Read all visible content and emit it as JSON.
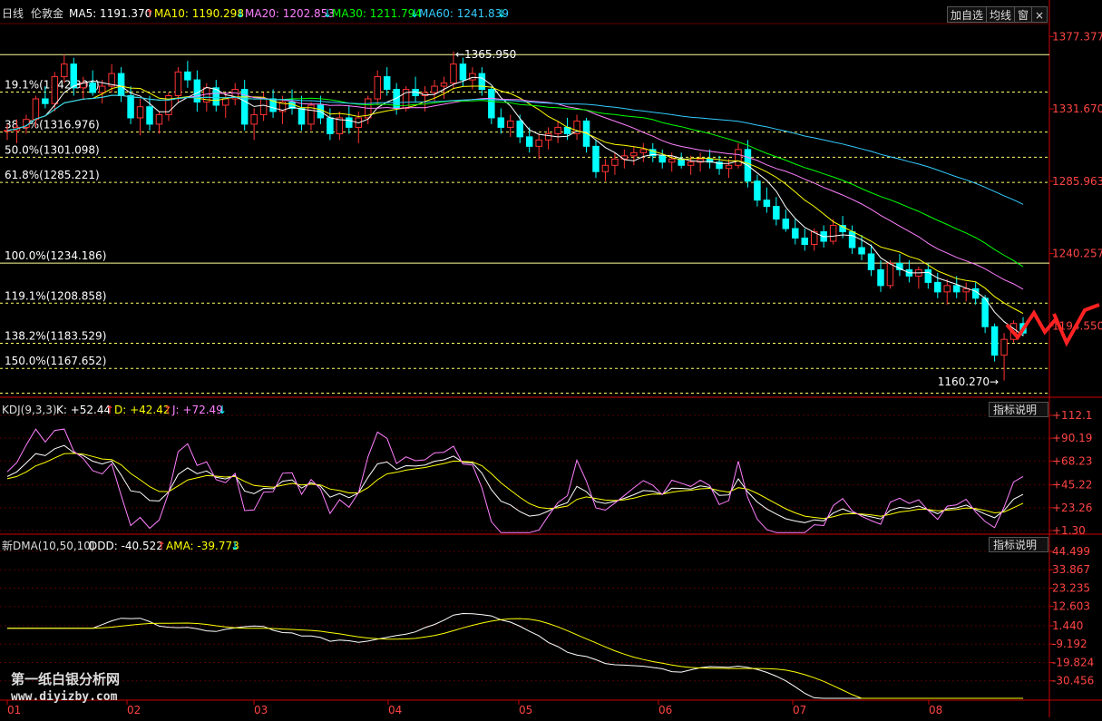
{
  "header": {
    "period": "日线",
    "symbol": "伦敦金",
    "ma5": "MA5: 1191.370",
    "ma10": "MA10: 1190.298",
    "ma20": "MA20: 1202.853",
    "ma30": "MA30: 1211.794",
    "ma60": "MA60: 1241.839",
    "arrow_up": "↑",
    "arrow_down": "↓",
    "btn_add": "加自选",
    "btn_avg": "均线",
    "btn_win": "窗",
    "btn_close": "×"
  },
  "main_chart": {
    "price_axis": [
      "1377.377",
      "1331.670",
      "1285.963",
      "1240.257",
      "1194.550"
    ],
    "fib_levels": [
      {
        "label": "19.1%(1342.304)",
        "value": 1342.304
      },
      {
        "label": "38.2%(1316.976)",
        "value": 1316.976
      },
      {
        "label": "50.0%(1301.098)",
        "value": 1301.098
      },
      {
        "label": "61.8%(1285.221)",
        "value": 1285.221
      },
      {
        "label": "100.0%(1234.186)",
        "value": 1234.186
      },
      {
        "label": "119.1%(1208.858)",
        "value": 1208.858
      },
      {
        "label": "138.2%(1183.529)",
        "value": 1183.529
      },
      {
        "label": "150.0%(1167.652)",
        "value": 1167.652
      }
    ],
    "high_label": "1365.950",
    "low_label": "1160.270"
  },
  "kdj": {
    "name": "KDJ(9,3,3)",
    "k": "K: +52.44",
    "d": "D: +42.42",
    "j": "J: +72.49",
    "btn": "指标说明",
    "axis": [
      "+112.1",
      "+90.19",
      "+68.23",
      "+45.22",
      "+23.26",
      "+1.30"
    ]
  },
  "dma": {
    "name": "新DMA(10,50,10)",
    "ddd": "DDD: -40.522",
    "ama": "AMA: -39.773",
    "btn": "指标说明",
    "axis": [
      "44.499",
      "33.867",
      "23.235",
      "12.603",
      "1.440",
      "-9.192",
      "-19.824",
      "-30.456"
    ]
  },
  "months": [
    "01",
    "02",
    "03",
    "04",
    "05",
    "06",
    "07",
    "08"
  ],
  "watermark": {
    "title": "第一纸白银分析网",
    "url": "www.diyizby.com"
  },
  "colors": {
    "up": "#ff3333",
    "down": "#00ffff",
    "ma5": "#ffffff",
    "ma10": "#ffff00",
    "ma20": "#ff80ff",
    "ma30": "#00ff00",
    "ma60": "#33ccff"
  },
  "chart_data": {
    "type": "candlestick",
    "instrument": "伦敦金",
    "period": "日线",
    "price_range": [
      1150,
      1385
    ],
    "candles_ohlc": [
      [
        1318,
        1322,
        1312,
        1318
      ],
      [
        1318,
        1325,
        1310,
        1320
      ],
      [
        1320,
        1328,
        1316,
        1325
      ],
      [
        1325,
        1340,
        1320,
        1338
      ],
      [
        1338,
        1346,
        1332,
        1335
      ],
      [
        1335,
        1355,
        1330,
        1352
      ],
      [
        1352,
        1366,
        1348,
        1360
      ],
      [
        1360,
        1364,
        1340,
        1345
      ],
      [
        1345,
        1352,
        1338,
        1348
      ],
      [
        1348,
        1356,
        1340,
        1342
      ],
      [
        1342,
        1350,
        1335,
        1346
      ],
      [
        1346,
        1360,
        1342,
        1354
      ],
      [
        1354,
        1358,
        1336,
        1340
      ],
      [
        1340,
        1346,
        1322,
        1326
      ],
      [
        1326,
        1338,
        1315,
        1333
      ],
      [
        1333,
        1340,
        1318,
        1322
      ],
      [
        1322,
        1330,
        1316,
        1328
      ],
      [
        1328,
        1342,
        1324,
        1340
      ],
      [
        1340,
        1358,
        1336,
        1355
      ],
      [
        1355,
        1362,
        1345,
        1350
      ],
      [
        1350,
        1356,
        1330,
        1336
      ],
      [
        1336,
        1348,
        1330,
        1345
      ],
      [
        1345,
        1350,
        1330,
        1334
      ],
      [
        1334,
        1342,
        1326,
        1338
      ],
      [
        1338,
        1348,
        1334,
        1344
      ],
      [
        1344,
        1350,
        1318,
        1322
      ],
      [
        1322,
        1332,
        1312,
        1328
      ],
      [
        1328,
        1342,
        1324,
        1338
      ],
      [
        1338,
        1344,
        1326,
        1330
      ],
      [
        1330,
        1340,
        1322,
        1336
      ],
      [
        1336,
        1344,
        1328,
        1332
      ],
      [
        1332,
        1340,
        1318,
        1322
      ],
      [
        1322,
        1336,
        1318,
        1334
      ],
      [
        1334,
        1340,
        1322,
        1326
      ],
      [
        1326,
        1332,
        1312,
        1316
      ],
      [
        1316,
        1330,
        1312,
        1326
      ],
      [
        1326,
        1334,
        1316,
        1320
      ],
      [
        1320,
        1330,
        1310,
        1326
      ],
      [
        1326,
        1340,
        1322,
        1338
      ],
      [
        1338,
        1356,
        1334,
        1352
      ],
      [
        1352,
        1358,
        1340,
        1344
      ],
      [
        1344,
        1348,
        1328,
        1332
      ],
      [
        1332,
        1346,
        1330,
        1344
      ],
      [
        1344,
        1352,
        1336,
        1340
      ],
      [
        1340,
        1346,
        1330,
        1342
      ],
      [
        1342,
        1350,
        1336,
        1346
      ],
      [
        1346,
        1352,
        1338,
        1348
      ],
      [
        1348,
        1368,
        1344,
        1360
      ],
      [
        1360,
        1364,
        1346,
        1350
      ],
      [
        1350,
        1358,
        1344,
        1354
      ],
      [
        1354,
        1358,
        1340,
        1344
      ],
      [
        1344,
        1346,
        1322,
        1326
      ],
      [
        1326,
        1332,
        1316,
        1320
      ],
      [
        1320,
        1328,
        1314,
        1324
      ],
      [
        1324,
        1328,
        1310,
        1314
      ],
      [
        1314,
        1320,
        1304,
        1308
      ],
      [
        1308,
        1316,
        1300,
        1312
      ],
      [
        1312,
        1320,
        1306,
        1316
      ],
      [
        1316,
        1324,
        1310,
        1320
      ],
      [
        1320,
        1326,
        1312,
        1316
      ],
      [
        1316,
        1328,
        1312,
        1324
      ],
      [
        1324,
        1326,
        1304,
        1308
      ],
      [
        1308,
        1312,
        1288,
        1292
      ],
      [
        1292,
        1300,
        1286,
        1296
      ],
      [
        1296,
        1304,
        1290,
        1300
      ],
      [
        1300,
        1306,
        1294,
        1302
      ],
      [
        1302,
        1308,
        1296,
        1304
      ],
      [
        1304,
        1310,
        1298,
        1306
      ],
      [
        1306,
        1310,
        1298,
        1302
      ],
      [
        1302,
        1306,
        1294,
        1298
      ],
      [
        1298,
        1304,
        1292,
        1300
      ],
      [
        1300,
        1304,
        1294,
        1296
      ],
      [
        1296,
        1302,
        1290,
        1298
      ],
      [
        1298,
        1304,
        1292,
        1300
      ],
      [
        1300,
        1306,
        1294,
        1298
      ],
      [
        1298,
        1302,
        1290,
        1294
      ],
      [
        1294,
        1300,
        1288,
        1296
      ],
      [
        1296,
        1310,
        1294,
        1306
      ],
      [
        1306,
        1312,
        1282,
        1286
      ],
      [
        1286,
        1290,
        1270,
        1274
      ],
      [
        1274,
        1282,
        1266,
        1270
      ],
      [
        1270,
        1276,
        1258,
        1262
      ],
      [
        1262,
        1268,
        1254,
        1256
      ],
      [
        1256,
        1262,
        1246,
        1250
      ],
      [
        1250,
        1256,
        1242,
        1246
      ],
      [
        1246,
        1256,
        1242,
        1254
      ],
      [
        1254,
        1258,
        1244,
        1248
      ],
      [
        1248,
        1262,
        1246,
        1258
      ],
      [
        1258,
        1264,
        1250,
        1254
      ],
      [
        1254,
        1258,
        1240,
        1244
      ],
      [
        1244,
        1252,
        1236,
        1240
      ],
      [
        1240,
        1246,
        1226,
        1230
      ],
      [
        1230,
        1236,
        1216,
        1220
      ],
      [
        1220,
        1236,
        1218,
        1234
      ],
      [
        1234,
        1240,
        1226,
        1230
      ],
      [
        1230,
        1236,
        1222,
        1226
      ],
      [
        1226,
        1232,
        1218,
        1230
      ],
      [
        1230,
        1234,
        1218,
        1222
      ],
      [
        1222,
        1228,
        1212,
        1216
      ],
      [
        1216,
        1224,
        1208,
        1220
      ],
      [
        1220,
        1226,
        1212,
        1216
      ],
      [
        1216,
        1222,
        1210,
        1218
      ],
      [
        1218,
        1222,
        1208,
        1212
      ],
      [
        1212,
        1214,
        1190,
        1194
      ],
      [
        1194,
        1196,
        1172,
        1176
      ],
      [
        1176,
        1190,
        1160,
        1186
      ],
      [
        1186,
        1198,
        1184,
        1196
      ],
      [
        1196,
        1200,
        1188,
        1190
      ]
    ],
    "fib_levels": [
      1342.304,
      1316.976,
      1301.098,
      1285.221,
      1234.186,
      1208.858,
      1183.529,
      1167.652
    ],
    "high": 1365.95,
    "low": 1160.27,
    "last_ma": {
      "MA5": 1191.37,
      "MA10": 1190.298,
      "MA20": 1202.853,
      "MA30": 1211.794,
      "MA60": 1241.839
    },
    "kdj": {
      "K": 52.44,
      "D": 42.42,
      "J": 72.49,
      "range": [
        1.3,
        112.1
      ]
    },
    "dma": {
      "DDD": -40.522,
      "AMA": -39.773,
      "range": [
        -30.456,
        44.499
      ]
    },
    "x_ticks": [
      "01",
      "02",
      "03",
      "04",
      "05",
      "06",
      "07",
      "08"
    ]
  }
}
